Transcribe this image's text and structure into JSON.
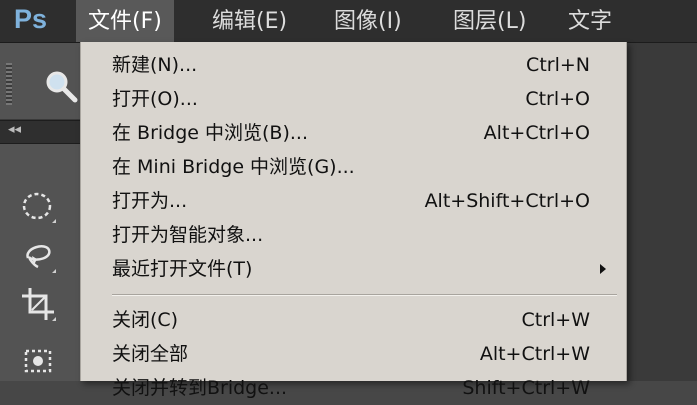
{
  "app": {
    "logo": "Ps"
  },
  "menubar": {
    "items": [
      {
        "label": "文件(F)",
        "active": true
      },
      {
        "label": "编辑(E)"
      },
      {
        "label": "图像(I)"
      },
      {
        "label": "图层(L)"
      },
      {
        "label": "文字"
      }
    ]
  },
  "toolbar": {
    "collapse_glyph": "◂◂",
    "icons": [
      "magnifier-icon",
      "elliptical-marquee-icon",
      "lasso-icon",
      "crop-icon",
      "quick-selection-icon"
    ]
  },
  "file_menu": {
    "items": [
      {
        "label": "新建(N)...",
        "shortcut": "Ctrl+N"
      },
      {
        "label": "打开(O)...",
        "shortcut": "Ctrl+O"
      },
      {
        "label": "在 Bridge 中浏览(B)...",
        "shortcut": "Alt+Ctrl+O"
      },
      {
        "label": "在 Mini Bridge 中浏览(G)...",
        "shortcut": ""
      },
      {
        "label": "打开为...",
        "shortcut": "Alt+Shift+Ctrl+O"
      },
      {
        "label": "打开为智能对象...",
        "shortcut": ""
      },
      {
        "label": "最近打开文件(T)",
        "shortcut": "",
        "submenu": true
      },
      {
        "label": "关闭(C)",
        "shortcut": "Ctrl+W"
      },
      {
        "label": "关闭全部",
        "shortcut": "Alt+Ctrl+W"
      },
      {
        "label": "关闭并转到Bridge...",
        "shortcut": "Shift+Ctrl+W"
      }
    ]
  },
  "colors": {
    "menubar_bg": "#2e2e2e",
    "menu_active_bg": "#595959",
    "dropdown_bg": "#d9d5cf",
    "logo_blue": "#7fb2dc"
  }
}
